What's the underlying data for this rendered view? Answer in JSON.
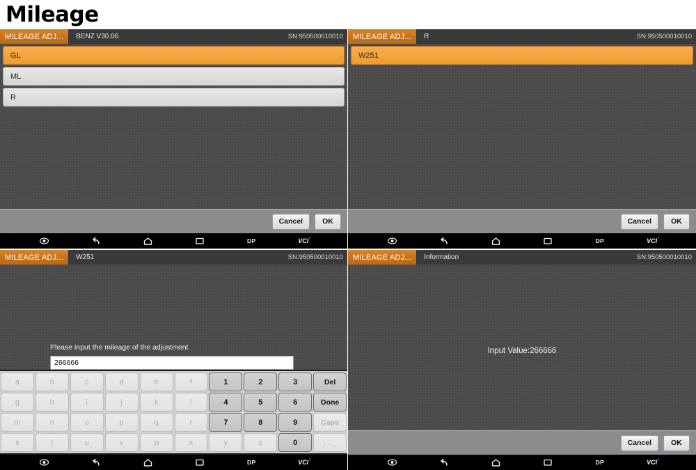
{
  "page": {
    "title": "Mileage"
  },
  "common": {
    "app_tab_label": "MILEAGE ADJ...",
    "serial": "SN:950500010010",
    "cancel_label": "Cancel",
    "ok_label": "OK",
    "navbar": [
      {
        "name": "vci-eye-icon",
        "type": "icon",
        "label": ""
      },
      {
        "name": "back-icon",
        "type": "icon",
        "label": ""
      },
      {
        "name": "home-icon",
        "type": "icon",
        "label": ""
      },
      {
        "name": "recents-icon",
        "type": "icon",
        "label": ""
      },
      {
        "name": "dp-button",
        "type": "text",
        "label": "DP"
      },
      {
        "name": "vci-button",
        "type": "vci",
        "label": "VCI"
      }
    ]
  },
  "screen1": {
    "subtitle": "BENZ  V30.06",
    "items": [
      {
        "label": "GL",
        "selected": true
      },
      {
        "label": "ML",
        "selected": false
      },
      {
        "label": "R",
        "selected": false
      }
    ]
  },
  "screen2": {
    "subtitle": "R",
    "items": [
      {
        "label": "W251",
        "selected": true
      }
    ]
  },
  "screen3": {
    "subtitle": "W251",
    "prompt": "Please input the mileage of the adjustment",
    "input_value": "266666",
    "input_placeholder": "",
    "keyboard": {
      "rows": [
        [
          {
            "label": "a",
            "active": false
          },
          {
            "label": "b",
            "active": false
          },
          {
            "label": "c",
            "active": false
          },
          {
            "label": "d",
            "active": false
          },
          {
            "label": "e",
            "active": false
          },
          {
            "label": "f",
            "active": false
          },
          {
            "label": "1",
            "active": true
          },
          {
            "label": "2",
            "active": true
          },
          {
            "label": "3",
            "active": true
          },
          {
            "label": "Del",
            "active": true,
            "word": true
          }
        ],
        [
          {
            "label": "g",
            "active": false
          },
          {
            "label": "h",
            "active": false
          },
          {
            "label": "i",
            "active": false
          },
          {
            "label": "j",
            "active": false
          },
          {
            "label": "k",
            "active": false
          },
          {
            "label": "l",
            "active": false
          },
          {
            "label": "4",
            "active": true
          },
          {
            "label": "5",
            "active": true
          },
          {
            "label": "6",
            "active": true
          },
          {
            "label": "Done",
            "active": true,
            "word": true
          }
        ],
        [
          {
            "label": "m",
            "active": false
          },
          {
            "label": "n",
            "active": false
          },
          {
            "label": "o",
            "active": false
          },
          {
            "label": "p",
            "active": false
          },
          {
            "label": "q",
            "active": false
          },
          {
            "label": "r",
            "active": false
          },
          {
            "label": "7",
            "active": true
          },
          {
            "label": "8",
            "active": true
          },
          {
            "label": "9",
            "active": true
          },
          {
            "label": "Caps",
            "active": false,
            "word": true
          }
        ],
        [
          {
            "label": "s",
            "active": false
          },
          {
            "label": "t",
            "active": false
          },
          {
            "label": "u",
            "active": false
          },
          {
            "label": "v",
            "active": false
          },
          {
            "label": "w",
            "active": false
          },
          {
            "label": "x",
            "active": false
          },
          {
            "label": "y",
            "active": false
          },
          {
            "label": "z",
            "active": false
          },
          {
            "label": "0",
            "active": true
          },
          {
            "label": ", . _",
            "active": false
          }
        ]
      ]
    }
  },
  "screen4": {
    "subtitle": "Information",
    "info_text": "Input Value:266666"
  }
}
